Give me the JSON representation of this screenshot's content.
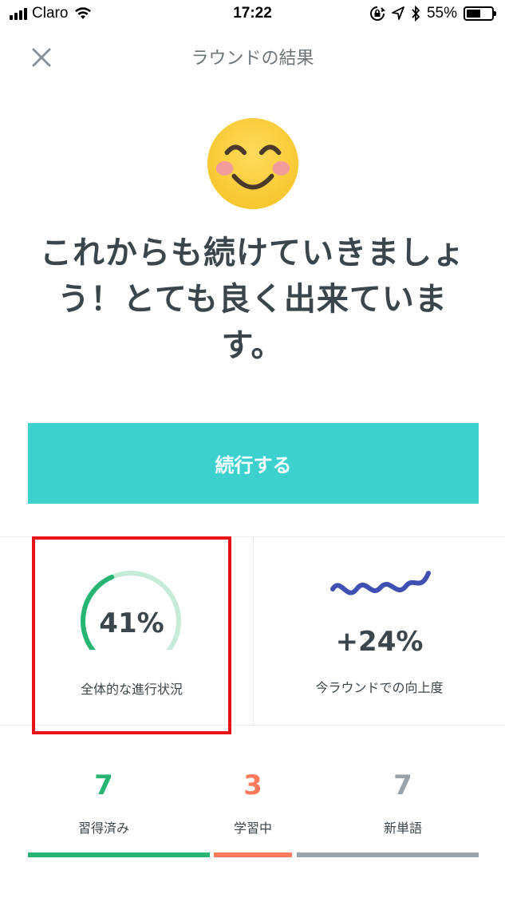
{
  "status_bar": {
    "carrier": "Claro",
    "time": "17:22",
    "battery": "55%",
    "battery_level": 0.55
  },
  "header": {
    "title": "ラウンドの結果",
    "close_icon": "close-icon"
  },
  "emoji": "smiling-face-icon",
  "headline": "これからも続けていきましょう！とても良く出来ています。",
  "continue_button": "続行する",
  "stats": {
    "progress": {
      "value": "41%",
      "fraction": 0.41,
      "label": "全体的な進行状況",
      "colors": {
        "fill": "#26b573",
        "track": "#c6ecd9"
      }
    },
    "improvement": {
      "value": "+24%",
      "label": "今ラウンドでの向上度",
      "wave_color": "#3f4fb2"
    }
  },
  "words": [
    {
      "count": "7",
      "label": "習得済み",
      "color": "#26b573"
    },
    {
      "count": "3",
      "label": "学習中",
      "color": "#ff7a5c"
    },
    {
      "count": "7",
      "label": "新単語",
      "color": "#9aa3a9"
    }
  ]
}
